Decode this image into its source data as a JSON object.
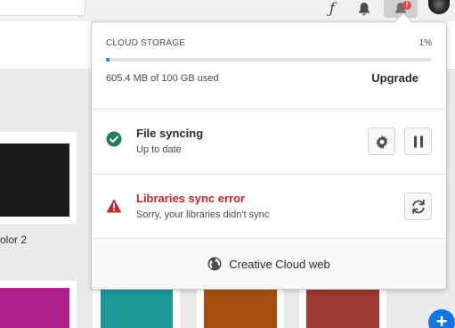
{
  "topbar": {
    "font_icon_glyph": "ƒ",
    "notification_badge": "!",
    "icons": [
      "fonts-icon",
      "bell-icon",
      "notification-icon",
      "avatar"
    ]
  },
  "background": {
    "card_label_partial": "olor 2",
    "swatch_colors": [
      "#1b1b1b",
      "#b01f8c",
      "#1a9a9a",
      "#a64f11",
      "#9c3a33"
    ]
  },
  "popover": {
    "storage": {
      "title": "CLOUD STORAGE",
      "percent": "1%",
      "fill_fraction": 0.01,
      "used_text": "605.4 MB of 100 GB used",
      "upgrade_label": "Upgrade",
      "accent_color": "#2680eb"
    },
    "file_sync": {
      "title": "File syncing",
      "status": "Up to date",
      "icons": [
        "check-circle-icon",
        "gear-icon",
        "pause-icon"
      ],
      "status_color": "#1e7f5c"
    },
    "libraries": {
      "title": "Libraries sync error",
      "message": "Sorry, your libraries didn't sync",
      "icons": [
        "warning-triangle-icon",
        "refresh-icon"
      ],
      "error_color": "#c9252d"
    },
    "web": {
      "label": "Creative Cloud web",
      "icon": "globe-icon"
    }
  },
  "fab_label": "+"
}
